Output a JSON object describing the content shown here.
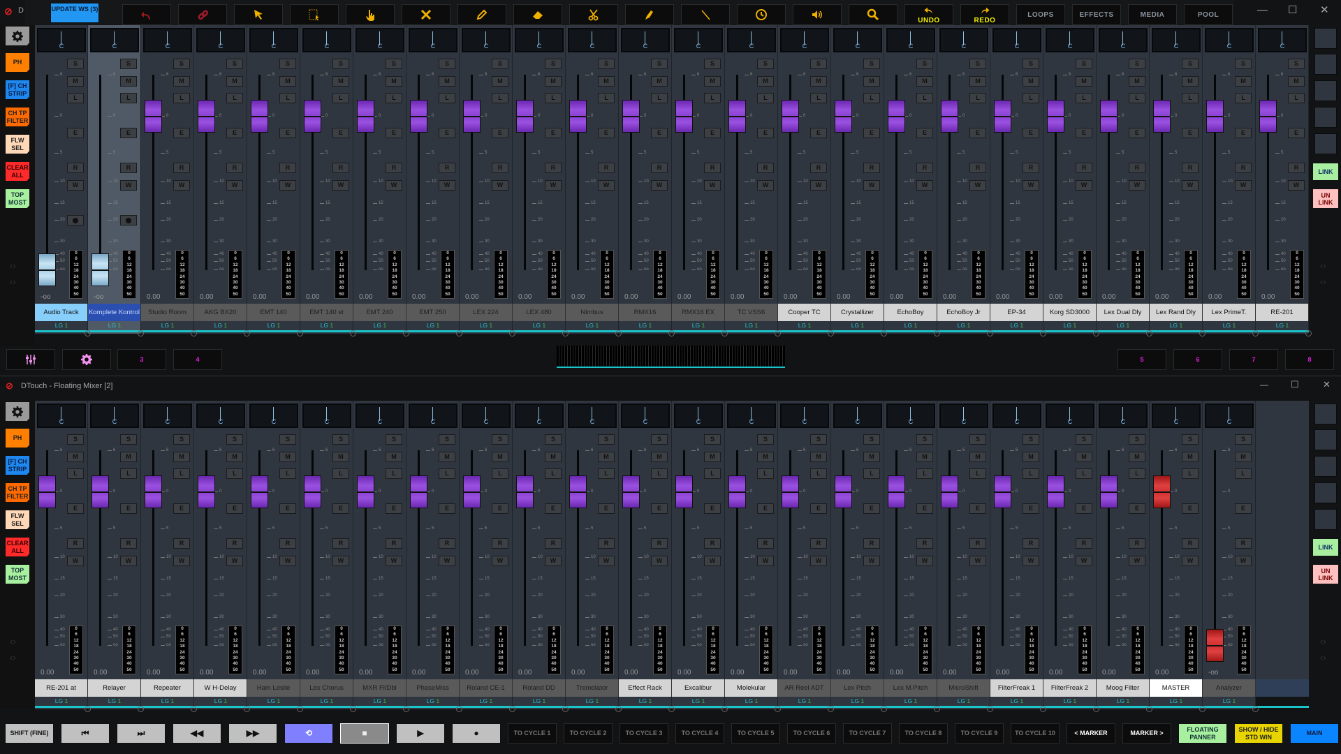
{
  "top_window": {
    "title": "D",
    "update_ws": "UPDATE WS (3)",
    "toolbar": [
      {
        "icon": "undo-arrow-icon",
        "label": "",
        "color": "#9b1b1b"
      },
      {
        "icon": "link-icon",
        "label": "",
        "color": "#9b1b2b"
      },
      {
        "icon": "pointer-icon",
        "label": "",
        "color": "#f0b000"
      },
      {
        "icon": "select-rect-icon",
        "label": "",
        "color": "#f0b000"
      },
      {
        "icon": "hand-icon",
        "label": "",
        "color": "#f0b000"
      },
      {
        "icon": "delete-x-icon",
        "label": "",
        "color": "#f0b000"
      },
      {
        "icon": "pencil-icon",
        "label": "",
        "color": "#f0b000"
      },
      {
        "icon": "eraser-icon",
        "label": "",
        "color": "#f0b000"
      },
      {
        "icon": "scissors-icon",
        "label": "",
        "color": "#f0b000"
      },
      {
        "icon": "paint-icon",
        "label": "",
        "color": "#f0b000"
      },
      {
        "icon": "line-icon",
        "label": "",
        "color": "#f0b000"
      },
      {
        "icon": "clock-icon",
        "label": "",
        "color": "#f0b000"
      },
      {
        "icon": "speaker-icon",
        "label": "",
        "color": "#f0b000"
      },
      {
        "icon": "search-icon",
        "label": "",
        "color": "#f0b000"
      },
      {
        "icon": "undo-icon",
        "label": "UNDO",
        "color": "#f0b000"
      },
      {
        "icon": "redo-icon",
        "label": "REDO",
        "color": "#f0b000"
      },
      {
        "icon": "",
        "label": "LOOPS",
        "color": ""
      },
      {
        "icon": "",
        "label": "EFFECTS",
        "color": ""
      },
      {
        "icon": "",
        "label": "MEDIA",
        "color": ""
      },
      {
        "icon": "",
        "label": "POOL",
        "color": ""
      }
    ],
    "window_controls": {
      "minimize": "—",
      "maximize": "☐",
      "close": "✕"
    }
  },
  "left_panel": [
    {
      "label": "",
      "icon": "gear-icon",
      "bg": "#9a9a9a",
      "fg": "#111"
    },
    {
      "label": "PH",
      "bg": "#ff7f00",
      "fg": "#222"
    },
    {
      "label": "[F] CH STRIP",
      "bg": "#1e88f0",
      "fg": "#0a1a40"
    },
    {
      "label": "CH TP FILTER",
      "bg": "#ff6a00",
      "fg": "#222"
    },
    {
      "label": "FLW SEL",
      "bg": "#ffd8b8",
      "fg": "#222"
    },
    {
      "label": "CLEAR ALL",
      "bg": "#ff2a2a",
      "fg": "#300"
    },
    {
      "label": "TOP MOST",
      "bg": "#a8f0a0",
      "fg": "#133"
    }
  ],
  "right_panel": {
    "link": "LINK",
    "unlink": "UN LINK",
    "link_bg": "#a8f0a0",
    "unlink_bg": "#ffc0c0"
  },
  "strip_labels": {
    "pan": "C",
    "solo": "S",
    "mute": "M",
    "listen": "L",
    "edit": "E",
    "read": "R",
    "write": "W",
    "group": "LG",
    "group_num": "1",
    "scale": [
      "6",
      "0",
      "5",
      "10",
      "15",
      "20",
      "30",
      "40",
      "50",
      "oo"
    ],
    "meter_scale": [
      "0",
      "6",
      "12",
      "18",
      "24",
      "30",
      "40",
      "50"
    ]
  },
  "colors": {
    "fader_purple": "#8a40d0",
    "fader_blue": "#a8d0e8",
    "fader_red": "#d03030",
    "name_light": "#d4d4d4",
    "name_gray": "#5a5a5a",
    "name_white": "#ffffff",
    "accent_cyan": "#19c5c9"
  },
  "top_strips": [
    {
      "name": "Audio Track",
      "value": "-oo",
      "fader": "blue",
      "name_style": "sky",
      "rec": true
    },
    {
      "name": "Komplete Kontrol",
      "value": "-oo",
      "fader": "blue",
      "name_style": "navy",
      "rec": true,
      "alt": true
    },
    {
      "name": "Studio Room",
      "value": "0.00",
      "fader": "purple",
      "name_style": "gray"
    },
    {
      "name": "AKG BX20",
      "value": "0.00",
      "fader": "purple",
      "name_style": "gray"
    },
    {
      "name": "EMT 140",
      "value": "0.00",
      "fader": "purple",
      "name_style": "gray"
    },
    {
      "name": "EMT 140 st",
      "value": "0.00",
      "fader": "purple",
      "name_style": "gray"
    },
    {
      "name": "EMT 240",
      "value": "0.00",
      "fader": "purple",
      "name_style": "gray"
    },
    {
      "name": "EMT 250",
      "value": "0.00",
      "fader": "purple",
      "name_style": "gray"
    },
    {
      "name": "LEX 224",
      "value": "0.00",
      "fader": "purple",
      "name_style": "gray"
    },
    {
      "name": "LEX 480",
      "value": "0.00",
      "fader": "purple",
      "name_style": "gray"
    },
    {
      "name": "Nimbus",
      "value": "0.00",
      "fader": "purple",
      "name_style": "gray"
    },
    {
      "name": "RMX16",
      "value": "0.00",
      "fader": "purple",
      "name_style": "gray"
    },
    {
      "name": "RMX16 EX",
      "value": "0.00",
      "fader": "purple",
      "name_style": "gray"
    },
    {
      "name": "TC VSS6",
      "value": "0.00",
      "fader": "purple",
      "name_style": "gray"
    },
    {
      "name": "Cooper TC",
      "value": "0.00",
      "fader": "purple",
      "name_style": "light"
    },
    {
      "name": "Crystallizer",
      "value": "0.00",
      "fader": "purple",
      "name_style": "light"
    },
    {
      "name": "EchoBoy",
      "value": "0.00",
      "fader": "purple",
      "name_style": "light"
    },
    {
      "name": "EchoBoy Jr",
      "value": "0.00",
      "fader": "purple",
      "name_style": "light"
    },
    {
      "name": "EP-34",
      "value": "0.00",
      "fader": "purple",
      "name_style": "light"
    },
    {
      "name": "Korg SD3000",
      "value": "0.00",
      "fader": "purple",
      "name_style": "light"
    },
    {
      "name": "Lex Dual Dly",
      "value": "0.00",
      "fader": "purple",
      "name_style": "light"
    },
    {
      "name": "Lex Rand Dly",
      "value": "0.00",
      "fader": "purple",
      "name_style": "light"
    },
    {
      "name": "Lex PrimeT.",
      "value": "0.00",
      "fader": "purple",
      "name_style": "light"
    },
    {
      "name": "RE-201",
      "value": "0.00",
      "fader": "purple",
      "name_style": "light"
    }
  ],
  "middle_bar": {
    "left": [
      {
        "icon": "mixer-sliders-icon",
        "label": ""
      },
      {
        "icon": "gear-icon",
        "label": ""
      },
      {
        "label": "3"
      },
      {
        "label": "4"
      }
    ],
    "right": [
      "5",
      "6",
      "7",
      "8"
    ]
  },
  "bottom_window": {
    "title": "DTouch - Floating Mixer [2]",
    "window_controls": {
      "minimize": "—",
      "maximize": "☐",
      "close": "✕"
    }
  },
  "bottom_strips": [
    {
      "name": "RE-201 at",
      "value": "0.00",
      "fader": "purple",
      "name_style": "light"
    },
    {
      "name": "Relayer",
      "value": "0.00",
      "fader": "purple",
      "name_style": "light"
    },
    {
      "name": "Repeater",
      "value": "0.00",
      "fader": "purple",
      "name_style": "light"
    },
    {
      "name": "W H-Delay",
      "value": "0.00",
      "fader": "purple",
      "name_style": "light"
    },
    {
      "name": "Ham Leslie",
      "value": "0.00",
      "fader": "purple",
      "name_style": "gray"
    },
    {
      "name": "Lex Chorus",
      "value": "0.00",
      "fader": "purple",
      "name_style": "gray"
    },
    {
      "name": "MXR Fl/Dbl",
      "value": "0.00",
      "fader": "purple",
      "name_style": "gray"
    },
    {
      "name": "PhaseMiss",
      "value": "0.00",
      "fader": "purple",
      "name_style": "gray"
    },
    {
      "name": "Roland CE-1",
      "value": "0.00",
      "fader": "purple",
      "name_style": "gray"
    },
    {
      "name": "Roland DD",
      "value": "0.00",
      "fader": "purple",
      "name_style": "gray"
    },
    {
      "name": "Tremolator",
      "value": "0.00",
      "fader": "purple",
      "name_style": "gray"
    },
    {
      "name": "Effect Rack",
      "value": "0.00",
      "fader": "purple",
      "name_style": "light"
    },
    {
      "name": "Excalibur",
      "value": "0.00",
      "fader": "purple",
      "name_style": "light"
    },
    {
      "name": "Molekular",
      "value": "0.00",
      "fader": "purple",
      "name_style": "light"
    },
    {
      "name": "AR Reel ADT",
      "value": "0.00",
      "fader": "purple",
      "name_style": "gray"
    },
    {
      "name": "Lex Pitch",
      "value": "0.00",
      "fader": "purple",
      "name_style": "gray"
    },
    {
      "name": "Lex M.Pitch",
      "value": "0.00",
      "fader": "purple",
      "name_style": "gray"
    },
    {
      "name": "MicroShift",
      "value": "0.00",
      "fader": "purple",
      "name_style": "gray"
    },
    {
      "name": "FilterFreak 1",
      "value": "0.00",
      "fader": "purple",
      "name_style": "light"
    },
    {
      "name": "FilterFreak 2",
      "value": "0.00",
      "fader": "purple",
      "name_style": "light"
    },
    {
      "name": "Moog Filter",
      "value": "0.00",
      "fader": "purple",
      "name_style": "light"
    },
    {
      "name": "MASTER",
      "value": "0.00",
      "fader": "red",
      "name_style": "white"
    },
    {
      "name": "Analyzer",
      "value": "-oo",
      "fader": "red",
      "name_style": "gray"
    }
  ],
  "transport": [
    {
      "label": "SHIFT (FINE)",
      "style": "gr"
    },
    {
      "icon": "go-to-start-icon",
      "glyph": "⏮",
      "style": "gr"
    },
    {
      "icon": "go-to-end-icon",
      "glyph": "⏭",
      "style": "gr"
    },
    {
      "icon": "rewind-icon",
      "glyph": "◀◀",
      "style": "gr"
    },
    {
      "icon": "fast-forward-icon",
      "glyph": "▶▶",
      "style": "gr"
    },
    {
      "icon": "loop-icon",
      "glyph": "⟲",
      "style": "loop"
    },
    {
      "icon": "stop-icon",
      "glyph": "■",
      "style": "stop"
    },
    {
      "icon": "play-icon",
      "glyph": "▶",
      "style": "gr"
    },
    {
      "icon": "record-icon",
      "glyph": "●",
      "style": "gr"
    },
    {
      "label": "TO CYCLE 1",
      "style": "dk"
    },
    {
      "label": "TO CYCLE 2",
      "style": "dk"
    },
    {
      "label": "TO CYCLE 3",
      "style": "dk"
    },
    {
      "label": "TO CYCLE 4",
      "style": "dk"
    },
    {
      "label": "TO CYCLE 5",
      "style": "dk"
    },
    {
      "label": "TO CYCLE 6",
      "style": "dk"
    },
    {
      "label": "TO CYCLE 7",
      "style": "dk"
    },
    {
      "label": "TO CYCLE 8",
      "style": "dk"
    },
    {
      "label": "TO CYCLE 9",
      "style": "dk"
    },
    {
      "label": "TO CYCLE 10",
      "style": "dk"
    },
    {
      "label": "< MARKER",
      "style": "mk"
    },
    {
      "label": "MARKER >",
      "style": "mk"
    },
    {
      "label": "FLOATING PANNER",
      "style": "fp"
    },
    {
      "label": "SHOW / HIDE STD WIN",
      "style": "sh"
    },
    {
      "label": "MAIN",
      "style": "main"
    }
  ]
}
